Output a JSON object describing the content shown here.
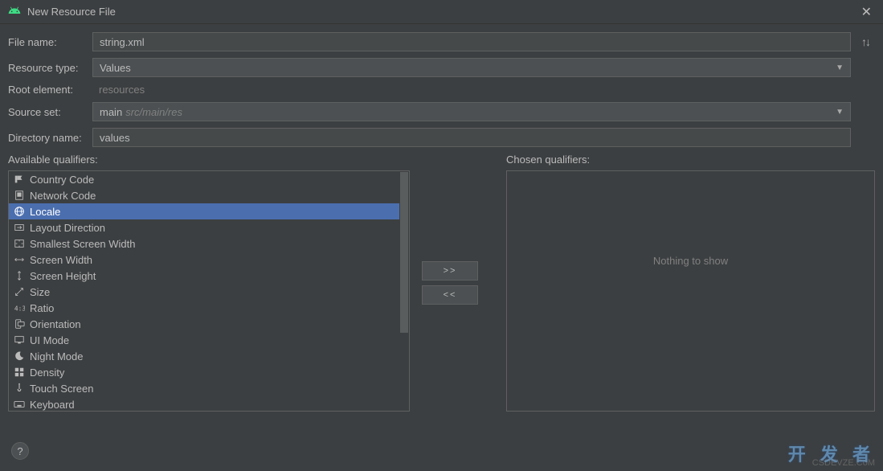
{
  "window": {
    "title": "New Resource File"
  },
  "form": {
    "filename_label": "File name:",
    "filename_value": "string.xml",
    "restype_label": "Resource type:",
    "restype_value": "Values",
    "rootelem_label": "Root element:",
    "rootelem_value": "resources",
    "sourceset_label": "Source set:",
    "sourceset_value": "main",
    "sourceset_path": "src/main/res",
    "dirname_label": "Directory name:",
    "dirname_value": "values"
  },
  "qualifiers": {
    "available_label": "Available qualifiers:",
    "chosen_label": "Chosen qualifiers:",
    "nothing": "Nothing to show",
    "add_btn": ">>",
    "remove_btn": "<<",
    "items": [
      {
        "label": "Country Code",
        "icon": "country"
      },
      {
        "label": "Network Code",
        "icon": "network"
      },
      {
        "label": "Locale",
        "icon": "globe",
        "selected": true
      },
      {
        "label": "Layout Direction",
        "icon": "layoutdir"
      },
      {
        "label": "Smallest Screen Width",
        "icon": "smallest"
      },
      {
        "label": "Screen Width",
        "icon": "width"
      },
      {
        "label": "Screen Height",
        "icon": "height"
      },
      {
        "label": "Size",
        "icon": "size"
      },
      {
        "label": "Ratio",
        "icon": "ratio"
      },
      {
        "label": "Orientation",
        "icon": "orientation"
      },
      {
        "label": "UI Mode",
        "icon": "uimode"
      },
      {
        "label": "Night Mode",
        "icon": "night"
      },
      {
        "label": "Density",
        "icon": "density"
      },
      {
        "label": "Touch Screen",
        "icon": "touch"
      },
      {
        "label": "Keyboard",
        "icon": "keyboard"
      }
    ]
  },
  "watermark": {
    "main": "开 发 者",
    "sub": "CSDEVZE.CoM"
  },
  "help": "?"
}
